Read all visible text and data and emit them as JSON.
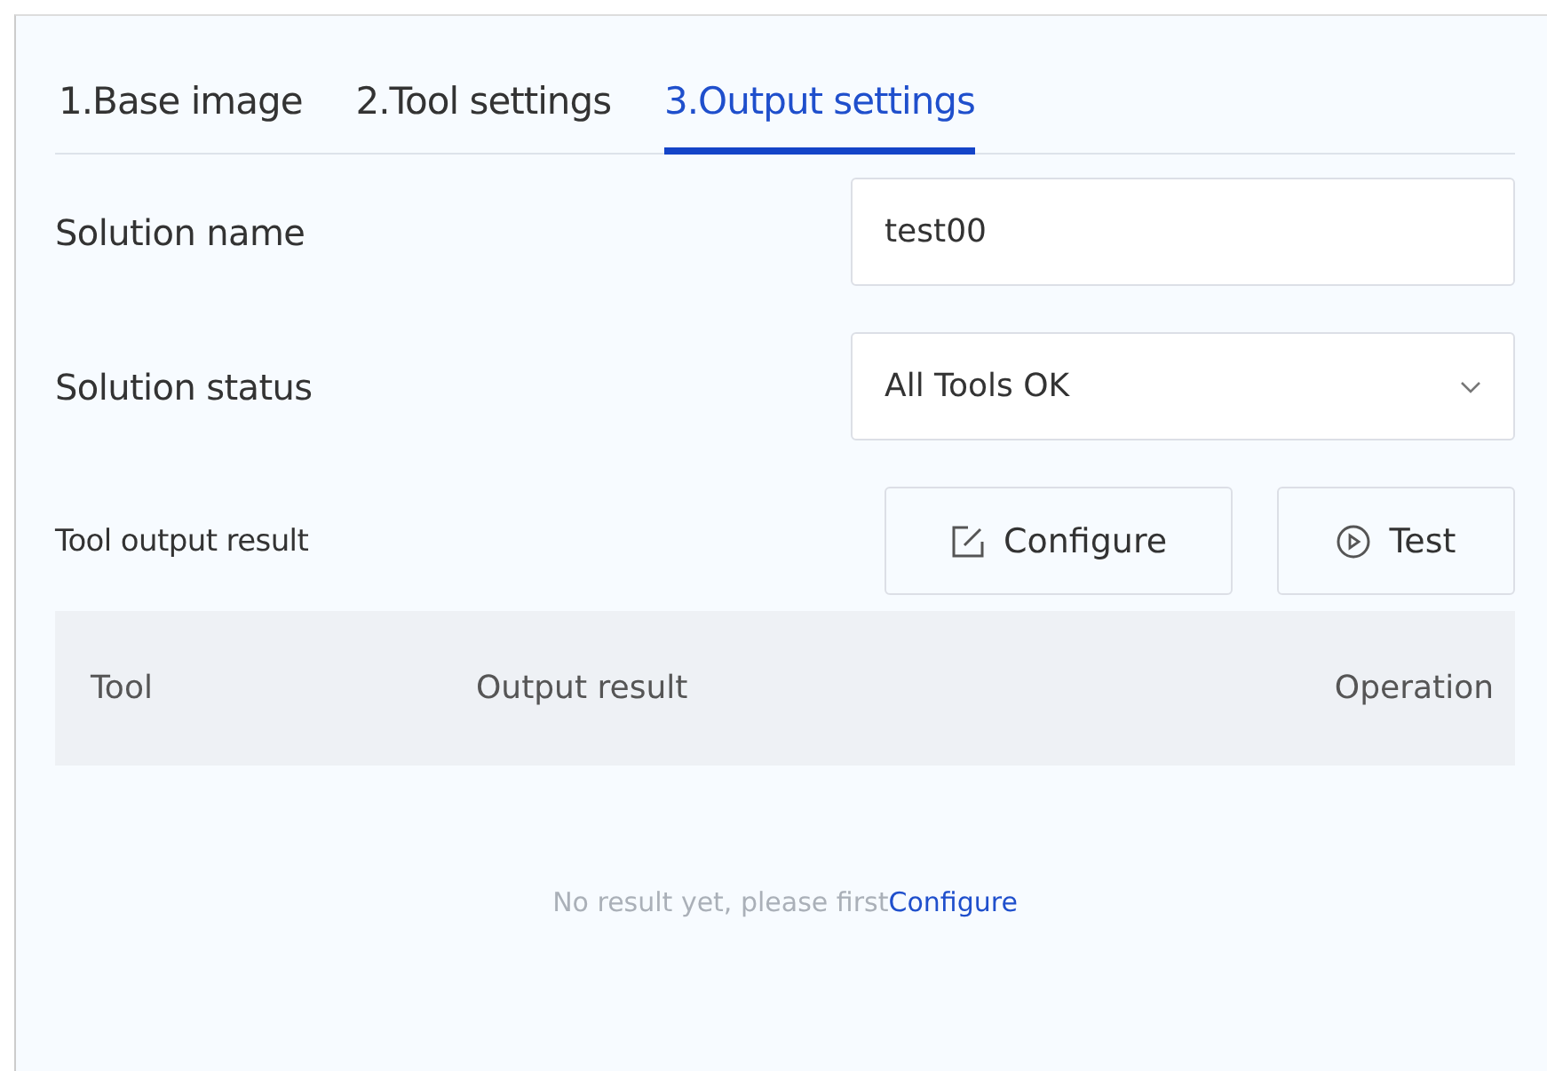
{
  "tabs": [
    {
      "label": "1.Base image",
      "selected": false
    },
    {
      "label": "2.Tool settings",
      "selected": false
    },
    {
      "label": "3.Output settings",
      "selected": true
    }
  ],
  "form": {
    "solution_name": {
      "label": "Solution name",
      "value": "test00"
    },
    "solution_status": {
      "label": "Solution status",
      "value": "All Tools OK"
    }
  },
  "tool_output": {
    "label": "Tool output result",
    "buttons": [
      "Configure",
      "Test"
    ]
  },
  "table": {
    "columns": [
      "Tool",
      "Output result",
      "Operation"
    ]
  },
  "empty": {
    "text": "No result yet, please first",
    "link": "Configure"
  }
}
